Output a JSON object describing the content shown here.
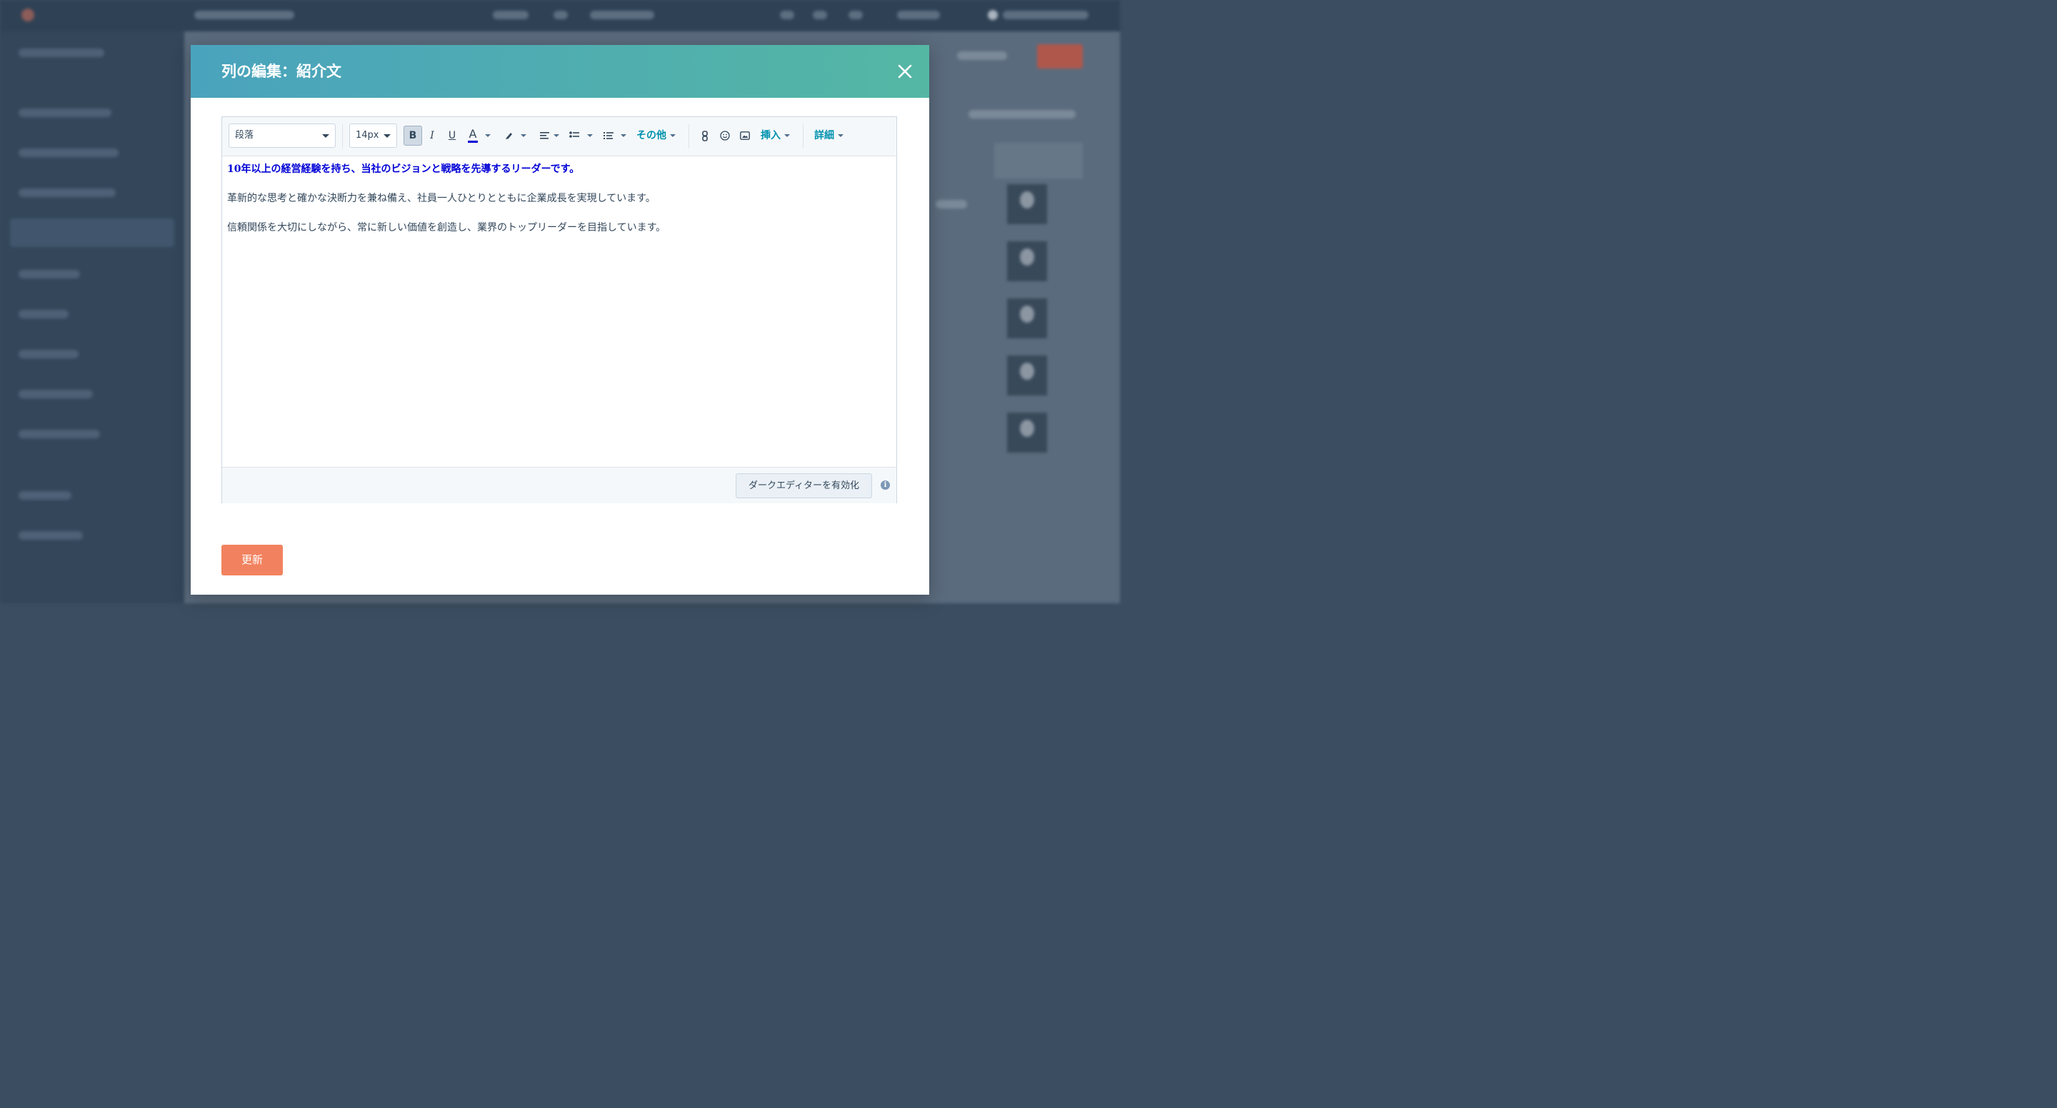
{
  "modal": {
    "title": "列の編集：紹介文",
    "close_icon": "close-icon"
  },
  "toolbar": {
    "block_format": "段落",
    "font_size": "14px",
    "bold_label": "B",
    "italic_label": "I",
    "underline_label": "U",
    "text_color_label": "A",
    "text_color": "#0000d6",
    "more_label": "その他",
    "insert_label": "挿入",
    "advanced_label": "詳細",
    "icons": [
      "highlighter-icon",
      "align-left-icon",
      "bulleted-list-icon",
      "numbered-list-icon",
      "link-icon",
      "emoji-icon",
      "image-icon"
    ]
  },
  "content": {
    "paragraphs": [
      "10年以上の経営経験を持ち、当社のビジョンと戦略を先導するリーダーです。",
      "革新的な思考と確かな決断力を兼ね備え、社員一人ひとりとともに企業成長を実現しています。",
      "信頼関係を大切にしながら、常に新しい価値を創造し、業界のトップリーダーを目指しています。"
    ]
  },
  "footer": {
    "dark_editor_label": "ダークエディターを有効化",
    "info_icon": "info-icon"
  },
  "actions": {
    "update_label": "更新",
    "update_color": "#f2825f"
  }
}
